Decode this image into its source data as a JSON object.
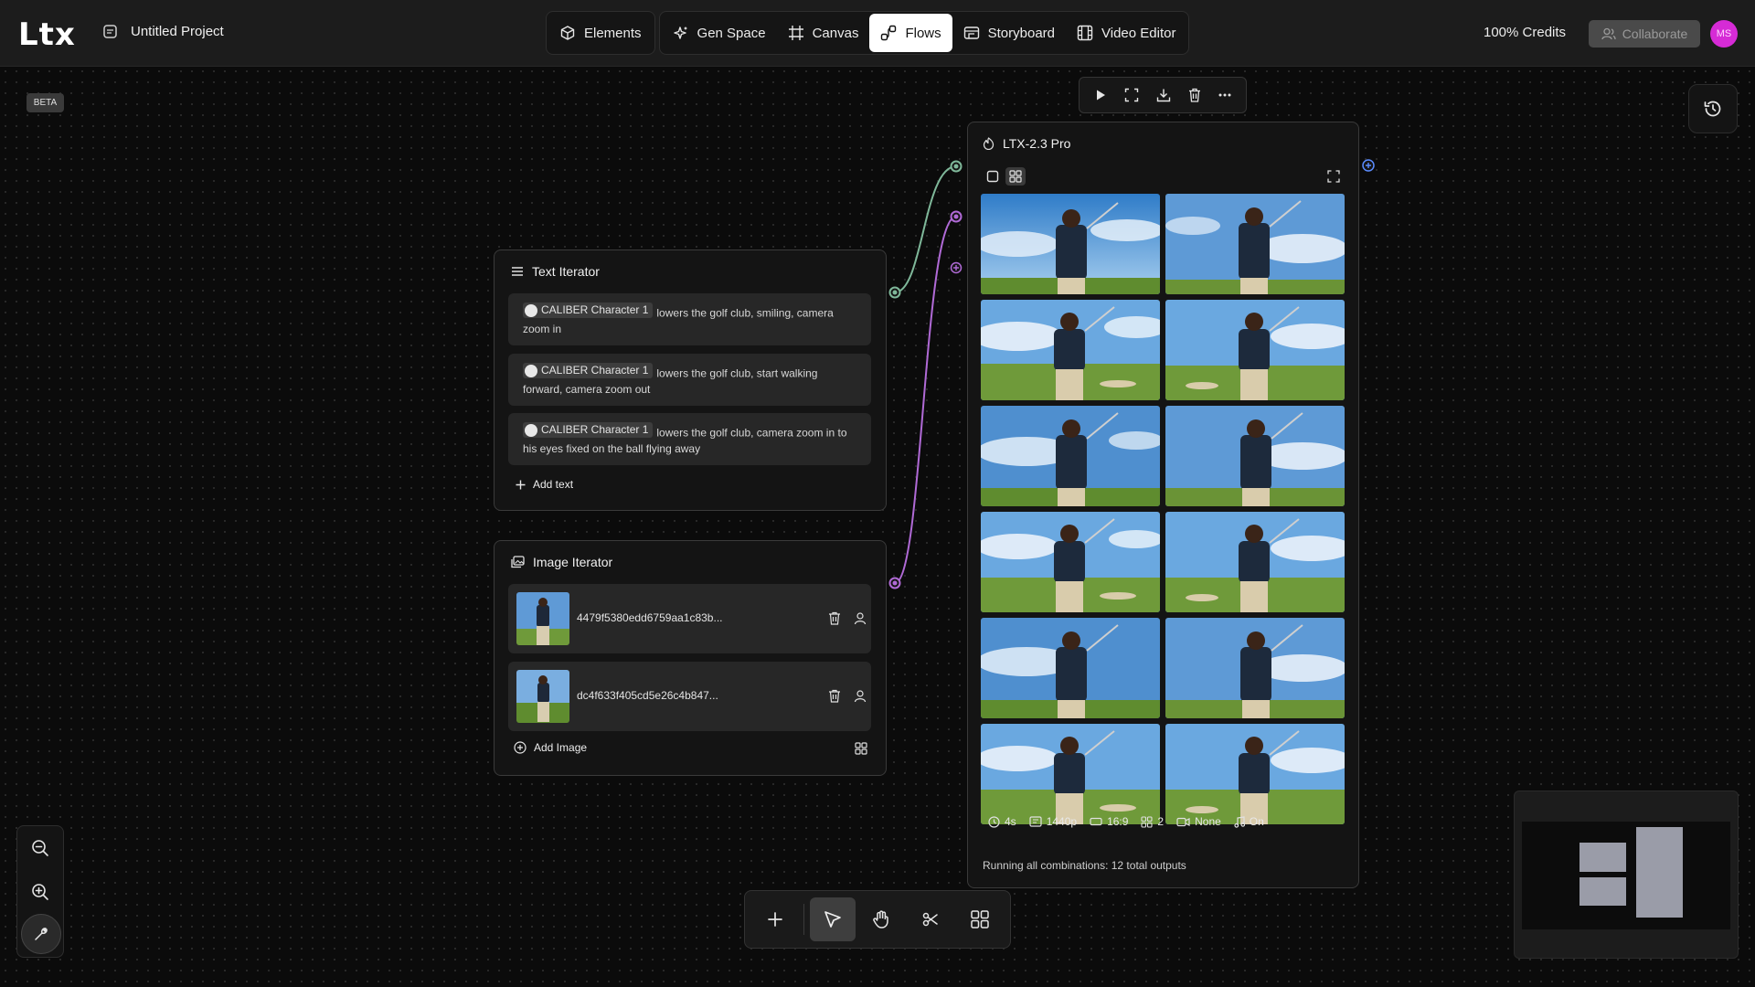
{
  "app": {
    "logo": "Ltx",
    "project_title": "Untitled Project"
  },
  "nav": {
    "items": [
      {
        "label": "Elements",
        "icon": "cube-icon"
      },
      {
        "label": "Gen Space",
        "icon": "sparkle-icon"
      },
      {
        "label": "Canvas",
        "icon": "frame-icon"
      },
      {
        "label": "Flows",
        "icon": "flows-icon",
        "active": true
      },
      {
        "label": "Storyboard",
        "icon": "storyboard-icon"
      },
      {
        "label": "Video Editor",
        "icon": "film-icon"
      }
    ]
  },
  "header": {
    "credits": "100% Credits",
    "collaborate_label": "Collaborate",
    "avatar_initials": "MS"
  },
  "badge": {
    "beta": "BETA"
  },
  "text_iterator": {
    "title": "Text Iterator",
    "prompts": [
      {
        "chip": "CALIBER Character 1",
        "text": "lowers the golf club, smiling, camera zoom in"
      },
      {
        "chip": "CALIBER Character 1",
        "text": "lowers the golf club, start walking forward, camera zoom out"
      },
      {
        "chip": "CALIBER Character 1",
        "text": "lowers the golf club, camera zoom in to his eyes fixed on the ball flying away"
      }
    ],
    "add_label": "Add text"
  },
  "image_iterator": {
    "title": "Image Iterator",
    "images": [
      {
        "name": "4479f5380edd6759aa1c83b..."
      },
      {
        "name": "dc4f633f405cd5e26c4b847..."
      }
    ],
    "add_label": "Add Image"
  },
  "ltx_node": {
    "title": "LTX-2.3 Pro",
    "params": [
      {
        "icon": "clock-icon",
        "label": "4s"
      },
      {
        "icon": "resolution-icon",
        "label": "1440p"
      },
      {
        "icon": "aspect-ratio-icon",
        "label": "16:9"
      },
      {
        "icon": "grid-icon",
        "label": "2"
      },
      {
        "icon": "camera-icon",
        "label": "None"
      },
      {
        "icon": "music-icon",
        "label": "On"
      }
    ],
    "status": "Running all combinations: 12 total outputs"
  },
  "colors": {
    "accent_green": "#7fb89a",
    "accent_purple": "#b06ad6",
    "accent_blue": "#5b8cff",
    "avatar": "#d62bd6"
  }
}
